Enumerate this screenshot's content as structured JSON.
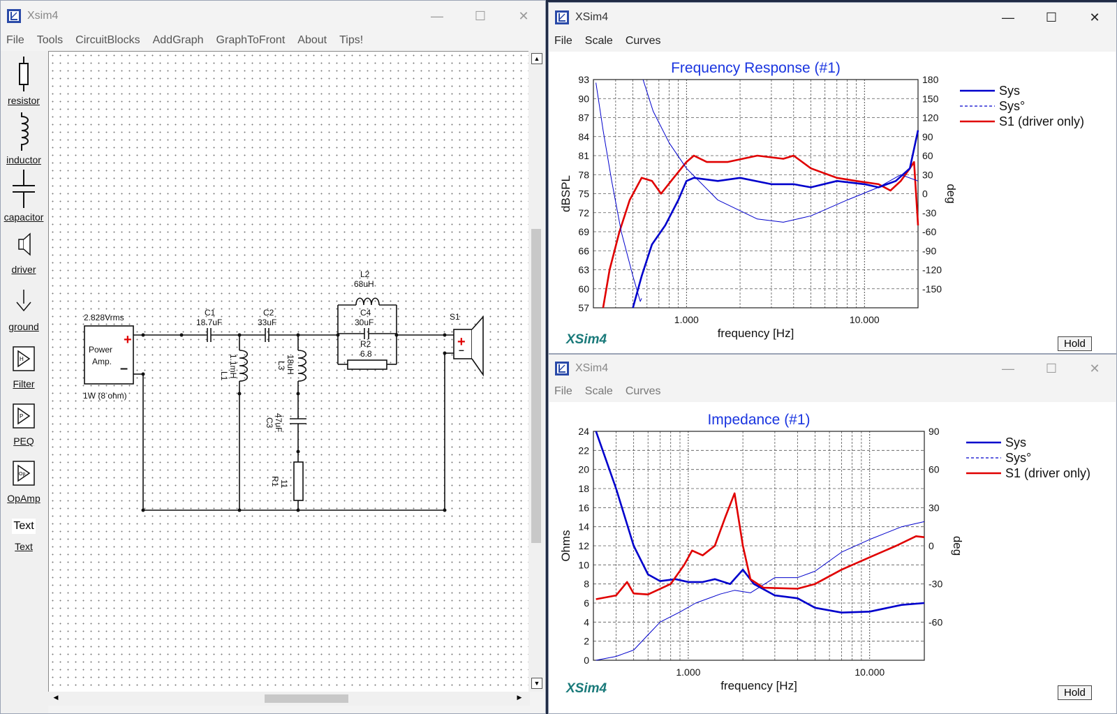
{
  "main_window": {
    "title": "Xsim4",
    "menu": [
      "File",
      "Tools",
      "CircuitBlocks",
      "AddGraph",
      "GraphToFront",
      "About",
      "Tips!"
    ],
    "palette": [
      "resistor",
      "inductor",
      "capacitor",
      "driver",
      "ground",
      "Filter",
      "PEQ",
      "OpAmp",
      "Text"
    ],
    "palette_text_glyph": "Text",
    "circuit": {
      "amp_voltage": "2.828Vrms",
      "amp_label_1": "Power",
      "amp_label_2": "Amp.",
      "amp_power": "1W (8 ohm)",
      "c1_name": "C1",
      "c1_value": "18.7uF",
      "c2_name": "C2",
      "c2_value": "33uF",
      "l1_name": "L1",
      "l1_value": "1.1mH",
      "l3_name": "L3",
      "l3_value": "18uH",
      "c3_name": "C3",
      "c3_value": "47uF",
      "r1_name": "R1",
      "r1_value": "11",
      "l2_name": "L2",
      "l2_value": "68uH",
      "c4_name": "C4",
      "c4_value": "30uF",
      "r2_name": "R2",
      "r2_value": "6.8",
      "s1_name": "S1"
    }
  },
  "graph_windows": [
    {
      "title": "XSim4",
      "menu": [
        "File",
        "Scale",
        "Curves"
      ],
      "logo": "XSim4",
      "hold": "Hold",
      "chart_data": {
        "type": "line",
        "title": "Frequency Response (#1)",
        "xlabel": "frequency [Hz]",
        "ylabel": "dBSPL",
        "y2label": "deg",
        "xscale": "log",
        "xlim": [
          300,
          20000
        ],
        "x_ticks": [
          "1.000",
          "10.000"
        ],
        "ylim": [
          57,
          93
        ],
        "y_ticks": [
          "93",
          "90",
          "87",
          "84",
          "81",
          "78",
          "75",
          "72",
          "69",
          "66",
          "63",
          "60",
          "57"
        ],
        "y2lim": [
          -180,
          180
        ],
        "y2_ticks": [
          "180",
          "150",
          "120",
          "90",
          "60",
          "30",
          "0",
          "-30",
          "-60",
          "-90",
          "-120",
          "-150"
        ],
        "legend": [
          "Sys",
          "Sys°",
          "S1 (driver only)"
        ],
        "legend_position": "right",
        "colors": {
          "Sys": "#0000cc",
          "Sys°": "#0000cc",
          "S1 (driver only)": "#e00000"
        },
        "series": [
          {
            "name": "S1 (driver only)",
            "axis": "left",
            "points": [
              [
                340,
                57
              ],
              [
                370,
                63
              ],
              [
                420,
                69
              ],
              [
                480,
                74
              ],
              [
                560,
                77.5
              ],
              [
                640,
                77
              ],
              [
                720,
                75
              ],
              [
                820,
                77
              ],
              [
                1000,
                80
              ],
              [
                1100,
                81
              ],
              [
                1300,
                80
              ],
              [
                1700,
                80
              ],
              [
                2500,
                81
              ],
              [
                3500,
                80.5
              ],
              [
                4000,
                81
              ],
              [
                5000,
                79
              ],
              [
                7000,
                77.5
              ],
              [
                9000,
                77
              ],
              [
                12000,
                76.5
              ],
              [
                14000,
                75.5
              ],
              [
                16000,
                77
              ],
              [
                18000,
                79
              ],
              [
                19000,
                80
              ],
              [
                20000,
                70
              ]
            ]
          },
          {
            "name": "Sys",
            "axis": "left",
            "points": [
              [
                500,
                57
              ],
              [
                560,
                62
              ],
              [
                640,
                67
              ],
              [
                760,
                70
              ],
              [
                900,
                74
              ],
              [
                1000,
                77
              ],
              [
                1100,
                77.5
              ],
              [
                1500,
                77
              ],
              [
                2000,
                77.5
              ],
              [
                3000,
                76.5
              ],
              [
                4000,
                76.5
              ],
              [
                5000,
                76
              ],
              [
                7000,
                77
              ],
              [
                10000,
                76.5
              ],
              [
                12000,
                76
              ],
              [
                15000,
                77
              ],
              [
                18000,
                79
              ],
              [
                20000,
                85
              ]
            ]
          },
          {
            "name": "Sys°",
            "axis": "right",
            "points": [
              [
                310,
                175
              ],
              [
                340,
                100
              ],
              [
                380,
                20
              ],
              [
                430,
                -60
              ],
              [
                500,
                -130
              ],
              [
                550,
                -170
              ],
              [
                560,
                -165
              ],
              [
                570,
                180
              ],
              [
                650,
                130
              ],
              [
                800,
                80
              ],
              [
                1000,
                40
              ],
              [
                1500,
                -10
              ],
              [
                2500,
                -40
              ],
              [
                3500,
                -45
              ],
              [
                5000,
                -35
              ],
              [
                8000,
                -10
              ],
              [
                12000,
                10
              ],
              [
                16000,
                30
              ],
              [
                20000,
                20
              ]
            ]
          }
        ]
      }
    },
    {
      "title": "XSim4",
      "menu": [
        "File",
        "Scale",
        "Curves"
      ],
      "logo": "XSim4",
      "hold": "Hold",
      "chart_data": {
        "type": "line",
        "title": "Impedance (#1)",
        "xlabel": "frequency [Hz]",
        "ylabel": "Ohms",
        "y2label": "deg",
        "xscale": "log",
        "xlim": [
          300,
          20000
        ],
        "x_ticks": [
          "1.000",
          "10.000"
        ],
        "ylim": [
          0,
          24
        ],
        "y_ticks": [
          "24",
          "22",
          "20",
          "18",
          "16",
          "14",
          "12",
          "10",
          "8",
          "6",
          "4",
          "2",
          "0"
        ],
        "y2lim": [
          -90,
          90
        ],
        "y2_ticks": [
          "90",
          "60",
          "30",
          "0",
          "-30",
          "-60"
        ],
        "legend": [
          "Sys",
          "Sys°",
          "S1 (driver only)"
        ],
        "legend_position": "right",
        "colors": {
          "Sys": "#0000cc",
          "Sys°": "#0000cc",
          "S1 (driver only)": "#e00000"
        },
        "series": [
          {
            "name": "Sys",
            "axis": "left",
            "points": [
              [
                310,
                24
              ],
              [
                400,
                18
              ],
              [
                500,
                12
              ],
              [
                600,
                9
              ],
              [
                700,
                8.3
              ],
              [
                850,
                8.5
              ],
              [
                1000,
                8.2
              ],
              [
                1200,
                8.2
              ],
              [
                1400,
                8.5
              ],
              [
                1700,
                8
              ],
              [
                2000,
                9.5
              ],
              [
                2300,
                8
              ],
              [
                3000,
                6.8
              ],
              [
                4000,
                6.5
              ],
              [
                5000,
                5.5
              ],
              [
                7000,
                5
              ],
              [
                10000,
                5.1
              ],
              [
                15000,
                5.8
              ],
              [
                20000,
                6
              ]
            ]
          },
          {
            "name": "Sys°",
            "axis": "right",
            "points": [
              [
                310,
                -90
              ],
              [
                400,
                -87
              ],
              [
                500,
                -82
              ],
              [
                600,
                -70
              ],
              [
                700,
                -60
              ],
              [
                900,
                -52
              ],
              [
                1100,
                -45
              ],
              [
                1500,
                -38
              ],
              [
                1800,
                -35
              ],
              [
                2200,
                -37
              ],
              [
                3000,
                -25
              ],
              [
                4000,
                -25
              ],
              [
                5000,
                -20
              ],
              [
                7000,
                -5
              ],
              [
                10000,
                5
              ],
              [
                15000,
                15
              ],
              [
                20000,
                19
              ]
            ]
          },
          {
            "name": "S1 (driver only)",
            "axis": "left",
            "points": [
              [
                310,
                6.4
              ],
              [
                400,
                6.8
              ],
              [
                460,
                8.2
              ],
              [
                500,
                7
              ],
              [
                600,
                6.9
              ],
              [
                800,
                8
              ],
              [
                950,
                10
              ],
              [
                1050,
                11.5
              ],
              [
                1200,
                11
              ],
              [
                1400,
                12
              ],
              [
                1600,
                15
              ],
              [
                1800,
                17.5
              ],
              [
                2000,
                12
              ],
              [
                2200,
                8.5
              ],
              [
                2600,
                7.6
              ],
              [
                4000,
                7.5
              ],
              [
                5000,
                8
              ],
              [
                7000,
                9.5
              ],
              [
                10000,
                10.8
              ],
              [
                14000,
                12
              ],
              [
                18000,
                13
              ],
              [
                20000,
                12.9
              ]
            ]
          }
        ]
      }
    }
  ]
}
